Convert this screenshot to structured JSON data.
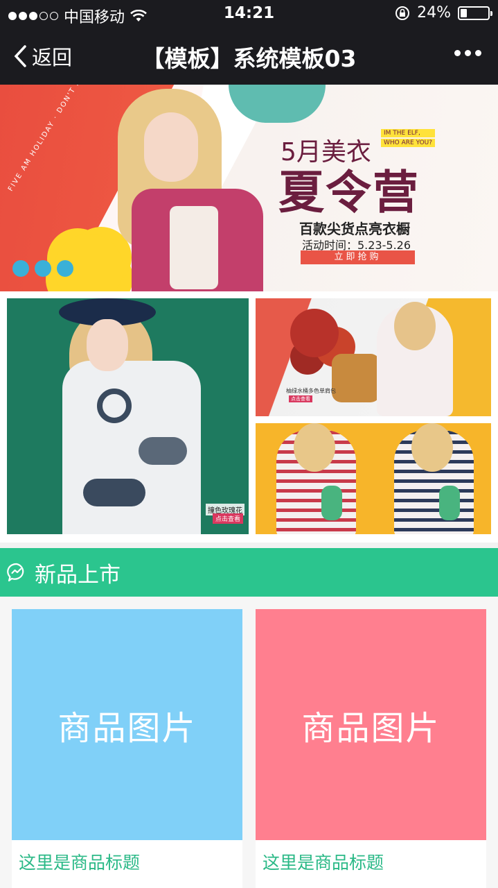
{
  "status_bar": {
    "carrier": "中国移动",
    "time": "14:21",
    "battery": "24%",
    "battery_level": 0.24,
    "signal_bars_filled": 3,
    "signal_bars_total": 5
  },
  "nav": {
    "back_label": "返回",
    "title": "【模板】系统模板03"
  },
  "banner": {
    "headline_small": "5月美衣",
    "headline_big": "夏令营",
    "tag_lines": [
      "IM THE ELF,",
      "WHO ARE YOU?"
    ],
    "subtitle": "百款尖货点亮衣橱",
    "activity_time": "活动时间：5.23-5.26",
    "button_label": "立即抢购",
    "ring_text": "FIVE AM HOLIDAY · DON'T AT HOME · COME OUT TO PLAY",
    "indicator_count": 3
  },
  "tiles": {
    "big_label": "撞色玫瑰花",
    "big_button": "点击查看",
    "top_right_label": "柚绿水桶多色单肩包",
    "top_right_button": "点击查看"
  },
  "section": {
    "title": "新品上市",
    "color": "#2bc58e"
  },
  "products": [
    {
      "image_text": "商品图片",
      "title": "这里是商品标题",
      "color": "#80d0f8"
    },
    {
      "image_text": "商品图片",
      "title": "这里是商品标题",
      "color": "#ff7f8f"
    }
  ]
}
